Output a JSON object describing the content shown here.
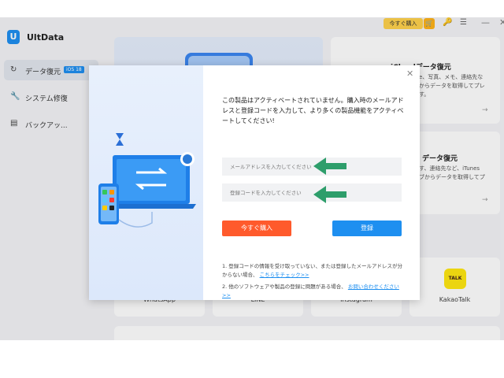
{
  "topbar": {
    "buy_now": "今すぐ購入",
    "icons": [
      "cart-icon",
      "key-icon",
      "menu-icon",
      "minimize-icon",
      "close-icon"
    ]
  },
  "sidebar": {
    "app_name": "UltData",
    "items": [
      {
        "label": "データ復元",
        "badge": "iOS 18",
        "icon": "restore-icon",
        "active": true
      },
      {
        "label": "システム修復",
        "icon": "wrench-icon",
        "active": false
      },
      {
        "label": "バックアッ...",
        "icon": "backup-icon",
        "active": false
      }
    ]
  },
  "cards": {
    "icloud": {
      "title": "iCloudデータ復元",
      "desc_line1": "e、写真、メモ、連絡先な",
      "desc_line2": "からデータを取得してプレ",
      "desc_line3": "す。"
    },
    "itunes": {
      "title": "データ復元",
      "desc_line1": "す、連絡先など、iTunes",
      "desc_line2": "ブからデータを取得してプ"
    },
    "apps": [
      {
        "label": "WhatsApp"
      },
      {
        "label": "LINE"
      },
      {
        "label": "Instagram"
      },
      {
        "label": "KakaoTalk",
        "logo_text": "TALK"
      }
    ]
  },
  "dialog": {
    "message": "この製品はアクティベートされていません。購入時のメールアドレスと登録コードを入力して、より多くの製品機能をアクティベートしてください!",
    "email_placeholder": "メールアドレスを入力してください",
    "code_placeholder": "登録コードを入力してください",
    "buy_button": "今すぐ購入",
    "register_button": "登録",
    "note1_text": "1. 登録コードの情報を受け取っていない、または登録したメールアドレスが分からない場合、",
    "note1_link": "こちらをチェック>>",
    "note2_text": "2. 他のソフトウェアや製品の登録に問題がある場合、",
    "note2_link": "お問い合わせください>>",
    "close_icon": "close-icon",
    "colors": {
      "buy": "#ff5a2c",
      "register": "#1e8ff0",
      "arrow": "#2e9e6b"
    }
  }
}
